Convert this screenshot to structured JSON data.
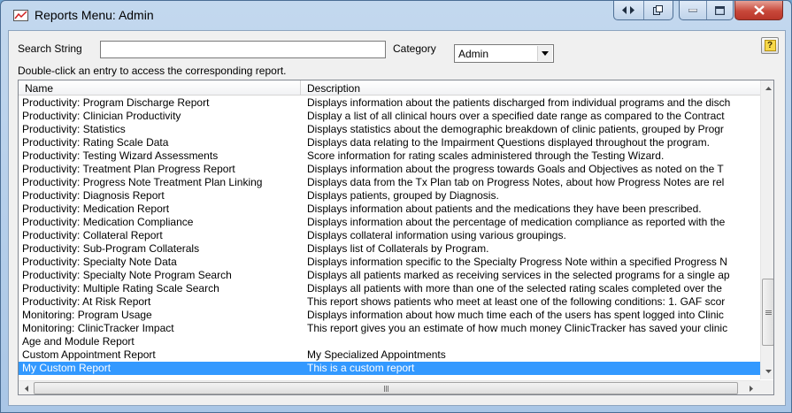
{
  "window": {
    "title": "Reports Menu: Admin"
  },
  "filters": {
    "search_label": "Search String",
    "search_value": "",
    "category_label": "Category",
    "category_value": "Admin"
  },
  "instructions": "Double-click an entry to access the corresponding report.",
  "table": {
    "columns": [
      "Name",
      "Description"
    ],
    "rows": [
      {
        "name": "Productivity: Program Discharge Report",
        "description": "Displays information about the patients discharged from individual programs and the disch"
      },
      {
        "name": "Productivity: Clinician Productivity",
        "description": "Display a list of all clinical hours over a specified date range as compared to the Contract"
      },
      {
        "name": "Productivity: Statistics",
        "description": "Displays statistics about the demographic breakdown of clinic patients, grouped by Progr"
      },
      {
        "name": "Productivity: Rating Scale Data",
        "description": "Displays data relating to the Impairment Questions displayed throughout the program."
      },
      {
        "name": "Productivity: Testing Wizard Assessments",
        "description": "Score information for rating scales administered through the Testing Wizard."
      },
      {
        "name": "Productivity: Treatment Plan Progress Report",
        "description": "Displays information about the progress towards Goals and Objectives as noted on the T"
      },
      {
        "name": "Productivity: Progress Note Treatment Plan Linking",
        "description": "Displays data from the Tx Plan tab on Progress Notes, about how Progress Notes are rel"
      },
      {
        "name": "Productivity: Diagnosis Report",
        "description": "Displays patients, grouped by Diagnosis."
      },
      {
        "name": "Productivity: Medication Report",
        "description": "Displays information about patients and the medications they have been prescribed."
      },
      {
        "name": "Productivity: Medication Compliance",
        "description": "Displays information about the percentage of medication compliance as reported with the"
      },
      {
        "name": "Productivity: Collateral Report",
        "description": "Displays collateral information using various groupings."
      },
      {
        "name": "Productivity: Sub-Program Collaterals",
        "description": "Displays list of Collaterals by Program."
      },
      {
        "name": "Productivity: Specialty Note Data",
        "description": "Displays information specific to the Specialty Progress Note within a specified Progress N"
      },
      {
        "name": "Productivity: Specialty Note Program Search",
        "description": "Displays all patients marked as receiving services in the selected programs for a single ap"
      },
      {
        "name": "Productivity: Multiple Rating Scale Search",
        "description": "Displays all patients with more than one of the selected rating scales completed over the"
      },
      {
        "name": "Productivity: At Risk Report",
        "description": "This report shows patients who meet at least one of the following conditions: 1. GAF scor"
      },
      {
        "name": "Monitoring: Program Usage",
        "description": "Displays information about how much time each of the users has spent logged into Clinic"
      },
      {
        "name": "Monitoring: ClinicTracker Impact",
        "description": "This report gives you an estimate of how much money ClinicTracker has saved your clinic"
      },
      {
        "name": "Age and Module Report",
        "description": ""
      },
      {
        "name": "Custom Appointment Report",
        "description": "My Specialized Appointments"
      },
      {
        "name": "My Custom Report",
        "description": "This is a custom report"
      }
    ],
    "selected_index": 20
  },
  "icons": {
    "title": "report-chart-icon",
    "help": "help-icon"
  }
}
